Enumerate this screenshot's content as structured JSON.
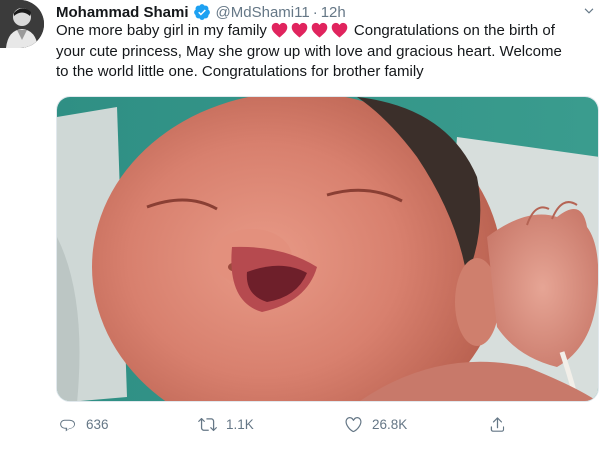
{
  "author": {
    "name": "Mohammad Shami",
    "handle": "@MdShami11",
    "separator": "·",
    "time": "12h",
    "verified": true
  },
  "tweet": {
    "line1_prefix": "One more baby girl in my family",
    "line1_suffix": "Congratulations on the birth of",
    "line2": "your cute princess, May she grow up with love and gracious heart. Welcome",
    "line3": "to the world little one. Congratulations for brother family",
    "emoji": [
      "red-heart",
      "red-heart",
      "red-heart",
      "red-heart"
    ],
    "emoji_color": "#e0245e"
  },
  "media": {
    "alt_subject": "newborn-baby-photo"
  },
  "actions": {
    "replies": "636",
    "retweets": "1.1K",
    "likes": "26.8K"
  },
  "colors": {
    "text": "#14171a",
    "secondary": "#657786",
    "verified": "#1da1f2",
    "border": "#e1e8ed"
  },
  "icons": {
    "reply": "reply-icon",
    "retweet": "retweet-icon",
    "like": "like-icon",
    "share": "share-icon",
    "more": "chevron-down-icon",
    "verified": "verified-badge-icon"
  }
}
